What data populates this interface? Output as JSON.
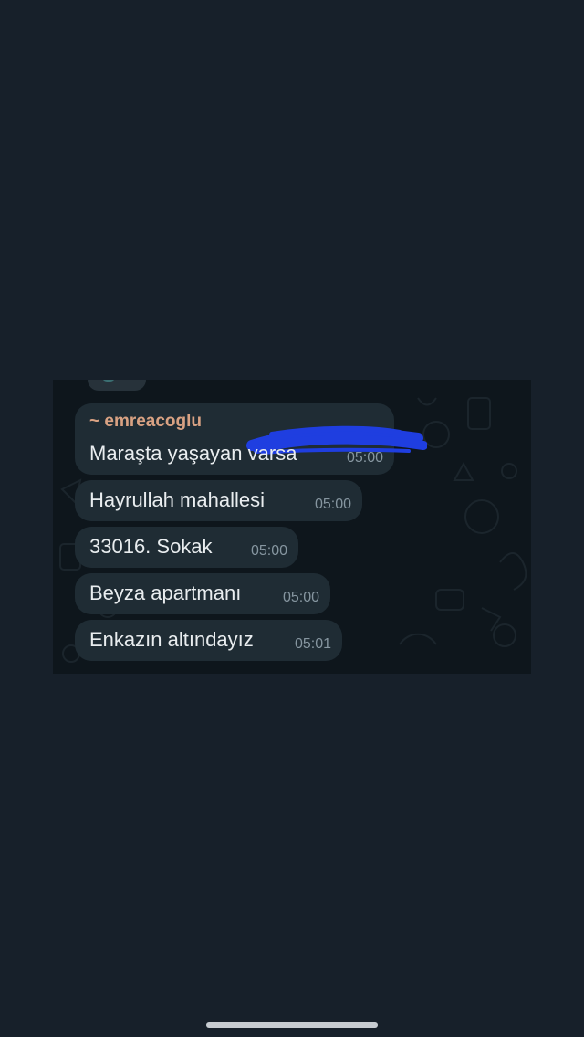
{
  "chat": {
    "sender": "~ emreacoglu",
    "messages": [
      {
        "text": "Maraşta yaşayan varsa",
        "time": "05:00"
      },
      {
        "text": "Hayrullah mahallesi",
        "time": "05:00"
      },
      {
        "text": "33016. Sokak",
        "time": "05:00"
      },
      {
        "text": "Beyza apartmanı",
        "time": "05:00"
      },
      {
        "text": "Enkazın altındayız",
        "time": "05:01"
      }
    ]
  },
  "colors": {
    "page_background": "#17202a",
    "chat_background": "#0e161c",
    "bubble": "#1f2c34",
    "sender_name": "#d9a283",
    "timestamp": "#8696a0",
    "redaction": "#1f3ee0"
  }
}
